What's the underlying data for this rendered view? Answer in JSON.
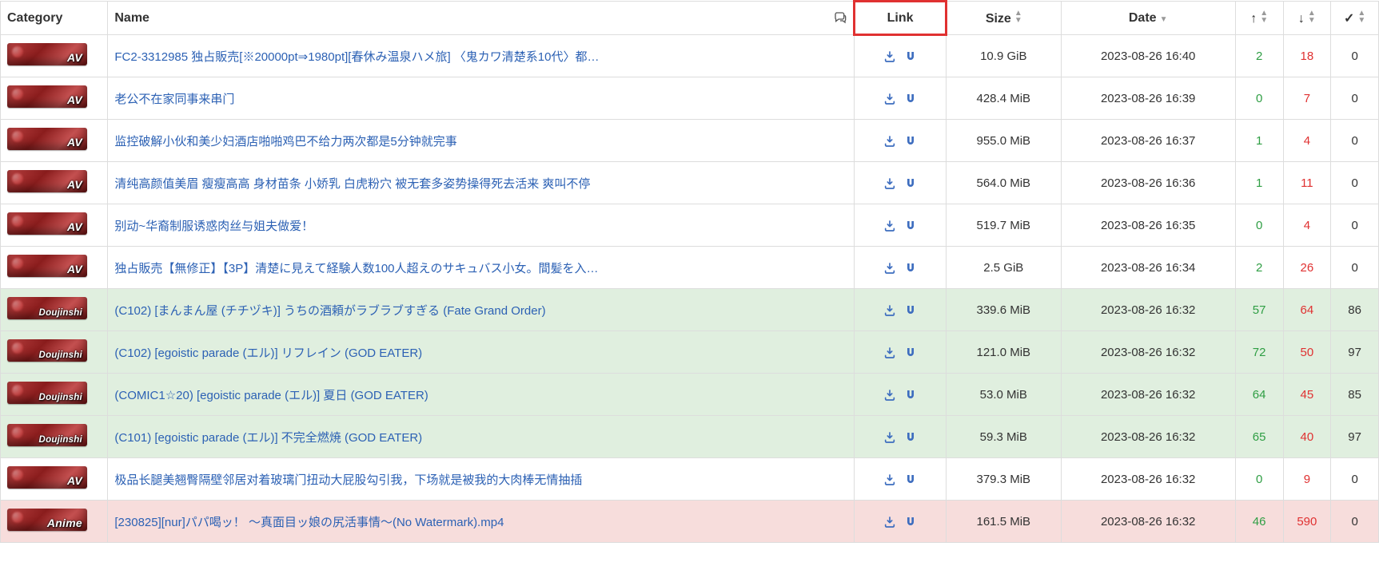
{
  "headers": {
    "category": "Category",
    "name": "Name",
    "link": "Link",
    "size": "Size",
    "date": "Date",
    "seeders_icon": "↑",
    "leechers_icon": "↓",
    "completed_icon": "✓"
  },
  "icons": {
    "download": "download-icon",
    "magnet": "magnet-icon",
    "comments": "comments-icon",
    "seed": "arrow-up-icon",
    "leech": "arrow-down-icon",
    "done": "check-icon"
  },
  "rows": [
    {
      "category": "AV",
      "cat_small": false,
      "name": "FC2-3312985 独占販売[※20000pt⇒1980pt][春休み温泉ハメ旅] 〈鬼カワ清楚系10代〉都…",
      "size": "10.9 GiB",
      "date": "2023-08-26 16:40",
      "seed": "2",
      "leech": "18",
      "done": "0",
      "class": "default"
    },
    {
      "category": "AV",
      "cat_small": false,
      "name": "老公不在家同事来串门",
      "size": "428.4 MiB",
      "date": "2023-08-26 16:39",
      "seed": "0",
      "leech": "7",
      "done": "0",
      "class": "default"
    },
    {
      "category": "AV",
      "cat_small": false,
      "name": "监控破解小伙和美少妇酒店啪啪鸡巴不给力两次都是5分钟就完事",
      "size": "955.0 MiB",
      "date": "2023-08-26 16:37",
      "seed": "1",
      "leech": "4",
      "done": "0",
      "class": "default"
    },
    {
      "category": "AV",
      "cat_small": false,
      "name": "清纯高颜值美眉 瘦瘦高高 身材苗条 小娇乳 白虎粉穴 被无套多姿势操得死去活来 爽叫不停",
      "size": "564.0 MiB",
      "date": "2023-08-26 16:36",
      "seed": "1",
      "leech": "11",
      "done": "0",
      "class": "default"
    },
    {
      "category": "AV",
      "cat_small": false,
      "name": "别动~华裔制服诱惑肉丝与姐夫做爱！",
      "size": "519.7 MiB",
      "date": "2023-08-26 16:35",
      "seed": "0",
      "leech": "4",
      "done": "0",
      "class": "default"
    },
    {
      "category": "AV",
      "cat_small": false,
      "name": "独占販売【無修正】【3P】清楚に見えて経験人数100人超えのサキュバス小女。間髪を入…",
      "size": "2.5 GiB",
      "date": "2023-08-26 16:34",
      "seed": "2",
      "leech": "26",
      "done": "0",
      "class": "default"
    },
    {
      "category": "Doujinshi",
      "cat_small": true,
      "name": "(C102) [まんまん屋 (チチヅキ)] うちの酒頼がラブラブすぎる (Fate Grand Order)",
      "size": "339.6 MiB",
      "date": "2023-08-26 16:32",
      "seed": "57",
      "leech": "64",
      "done": "86",
      "class": "remake"
    },
    {
      "category": "Doujinshi",
      "cat_small": true,
      "name": "(C102) [egoistic parade (エル)] リフレイン (GOD EATER)",
      "size": "121.0 MiB",
      "date": "2023-08-26 16:32",
      "seed": "72",
      "leech": "50",
      "done": "97",
      "class": "remake"
    },
    {
      "category": "Doujinshi",
      "cat_small": true,
      "name": "(COMIC1☆20) [egoistic parade (エル)] 夏日 (GOD EATER)",
      "size": "53.0 MiB",
      "date": "2023-08-26 16:32",
      "seed": "64",
      "leech": "45",
      "done": "85",
      "class": "remake"
    },
    {
      "category": "Doujinshi",
      "cat_small": true,
      "name": "(C101) [egoistic parade (エル)] 不完全燃焼 (GOD EATER)",
      "size": "59.3 MiB",
      "date": "2023-08-26 16:32",
      "seed": "65",
      "leech": "40",
      "done": "97",
      "class": "remake"
    },
    {
      "category": "AV",
      "cat_small": false,
      "name": "极品长腿美翘臀隔壁邻居对着玻璃门扭动大屁股勾引我，下场就是被我的大肉棒无情抽插",
      "size": "379.3 MiB",
      "date": "2023-08-26 16:32",
      "seed": "0",
      "leech": "9",
      "done": "0",
      "class": "default"
    },
    {
      "category": "Anime",
      "cat_small": false,
      "name": "[230825][nur]パパ喝ッ！ ～真面目ッ娘の尻活事情～(No Watermark).mp4",
      "size": "161.5 MiB",
      "date": "2023-08-26 16:32",
      "seed": "46",
      "leech": "590",
      "done": "0",
      "class": "danger"
    }
  ]
}
